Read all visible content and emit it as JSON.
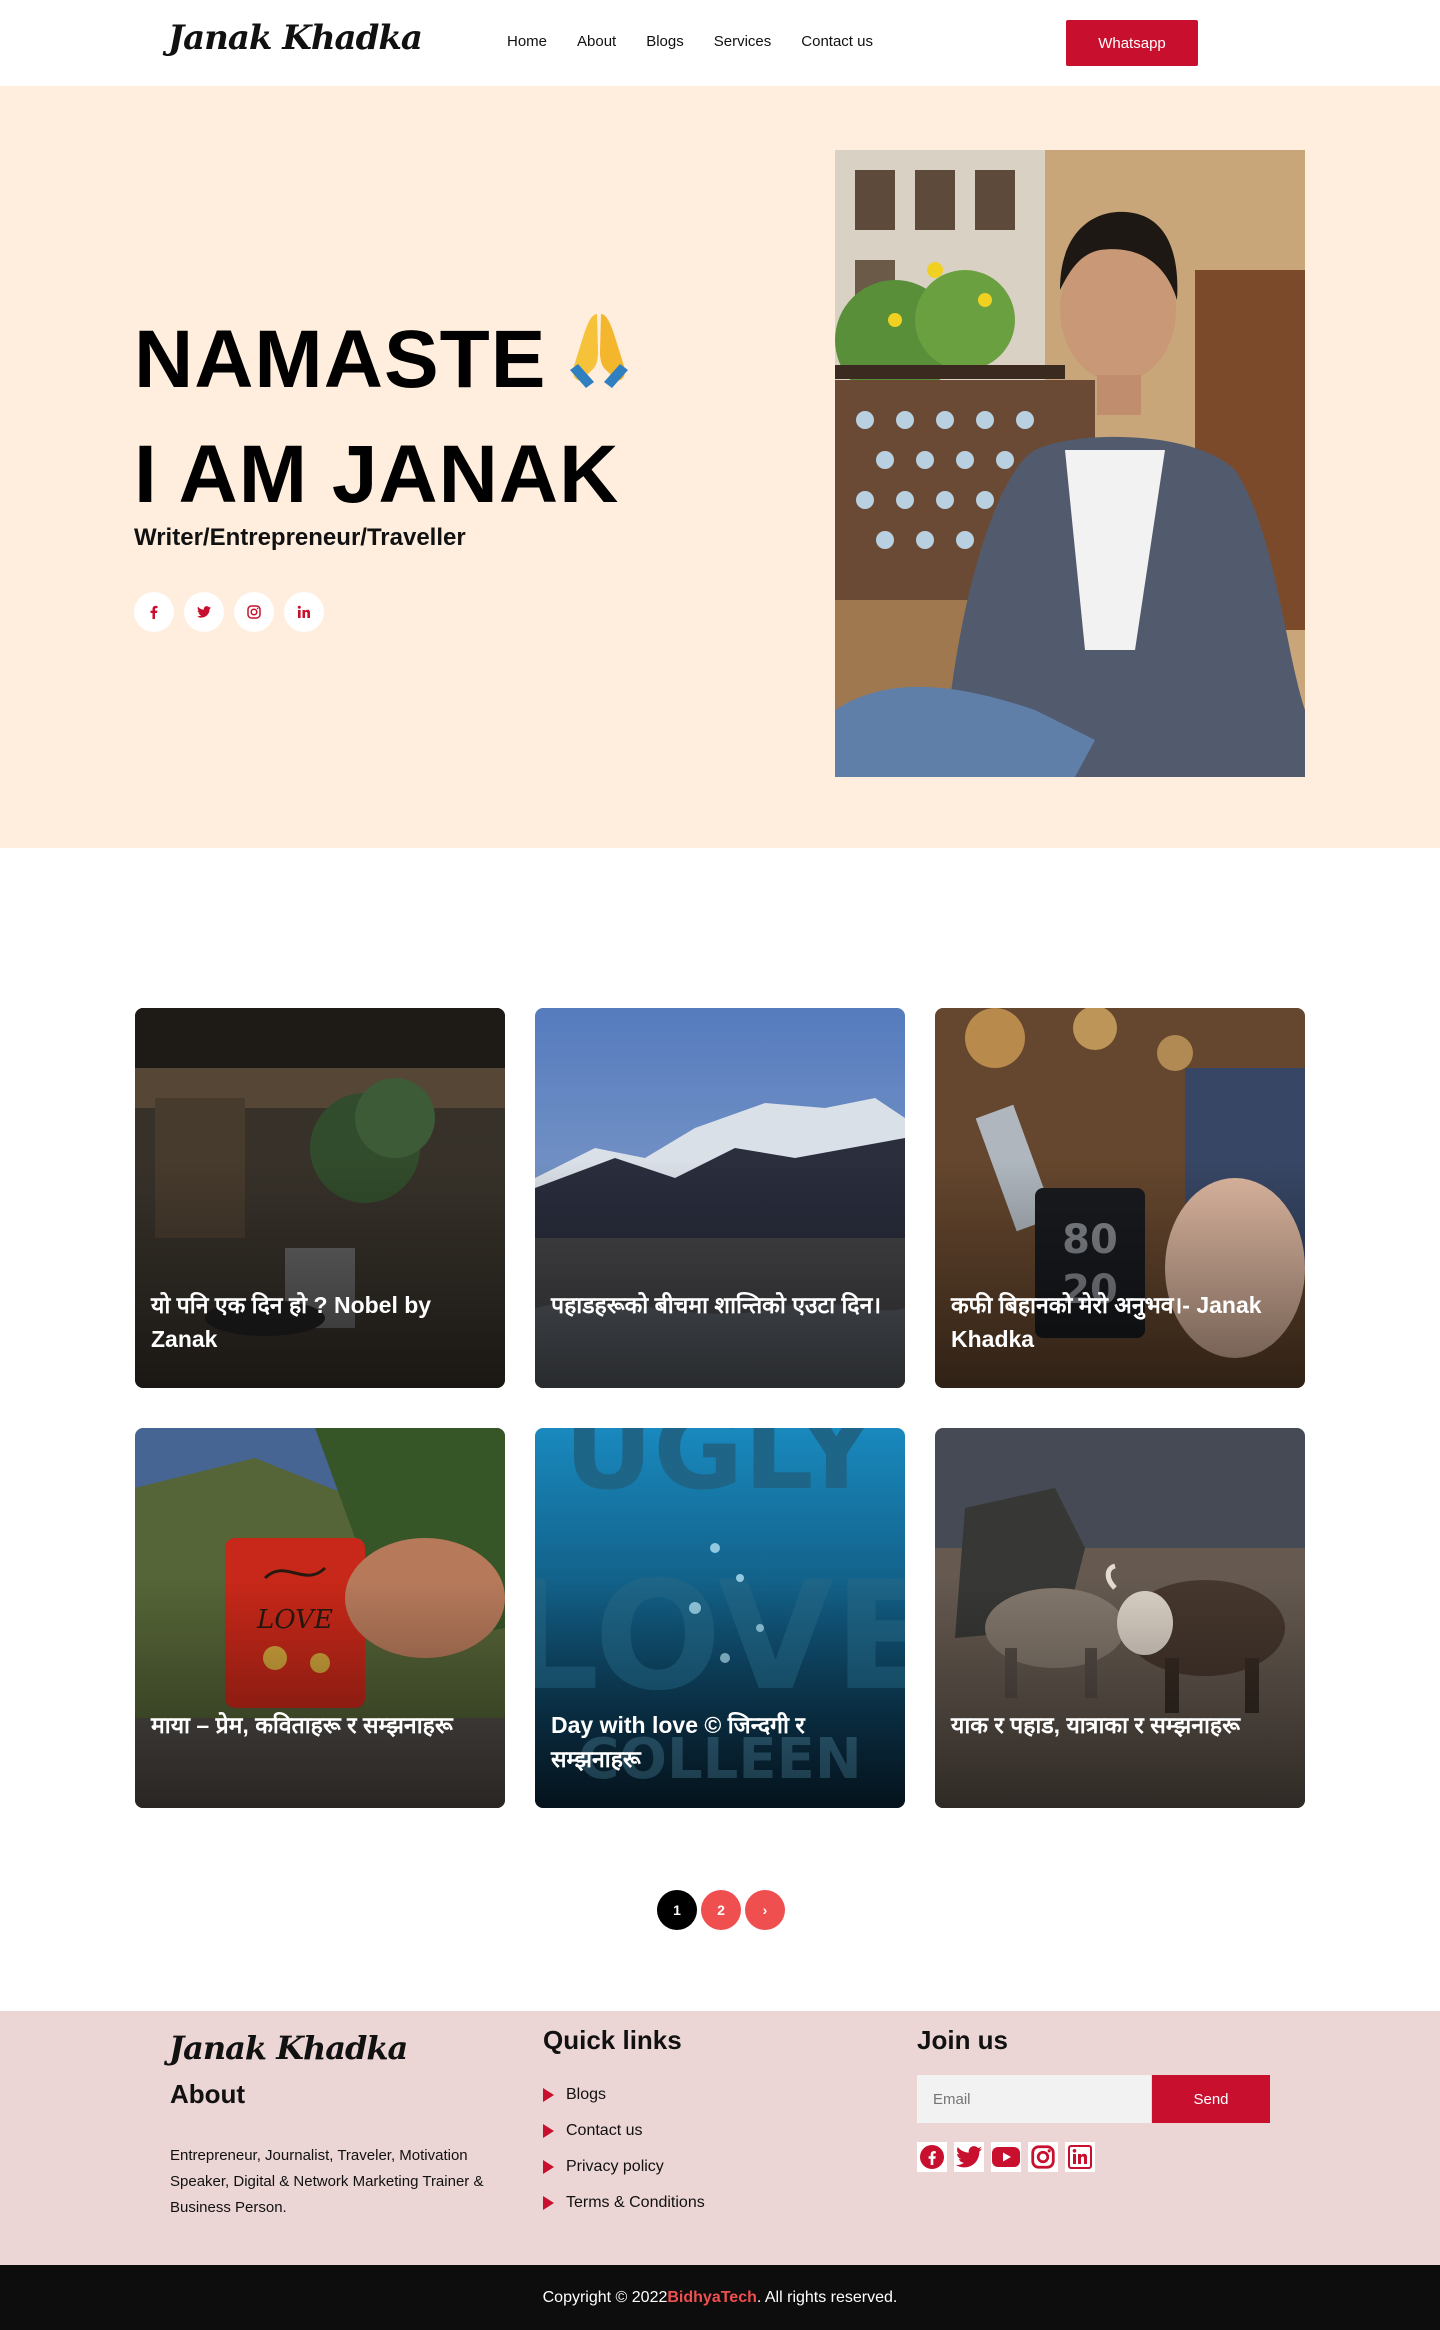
{
  "header": {
    "logo": "Janak Khadka",
    "nav": [
      "Home",
      "About",
      "Blogs",
      "Services",
      "Contact us"
    ],
    "cta": "Whatsapp"
  },
  "hero": {
    "line1": "NAMASTE",
    "line2": "I AM JANAK",
    "role": "Writer/Entrepreneur/Traveller",
    "socials": [
      "facebook-icon",
      "twitter-icon",
      "instagram-icon",
      "linkedin-icon"
    ]
  },
  "blogs": [
    {
      "title": "यो पनि एक दिन हो ? Nobel by Zanak",
      "scene": "cafe"
    },
    {
      "title": "पहाडहरूको बीचमा शान्तिको एउटा दिन।",
      "scene": "mountain"
    },
    {
      "title": "कफी बिहानको मेरो अनुभव।- Janak Khadka",
      "scene": "mug"
    },
    {
      "title": "माया – प्रेम, कविताहरू र सम्झनाहरू",
      "scene": "redmug"
    },
    {
      "title": "Day with love © जिन्दगी र सम्झनाहरू",
      "scene": "book"
    },
    {
      "title": "याक र पहाड, यात्राका र सम्झनाहरू",
      "scene": "yak"
    }
  ],
  "pagination": {
    "pages": [
      "1",
      "2"
    ],
    "next": "›",
    "current": "1"
  },
  "footer": {
    "logo": "Janak Khadka",
    "about_heading": "About",
    "about_text": "Entrepreneur, Journalist, Traveler,  Motivation Speaker, Digital & Network Marketing Trainer & Business Person.",
    "quick_heading": "Quick links",
    "quick_links": [
      "Blogs",
      "Contact us",
      "Privacy policy",
      "Terms & Conditions"
    ],
    "join_heading": "Join us",
    "email_placeholder": "Email",
    "send_label": "Send",
    "social_icons": [
      "facebook-icon",
      "twitter-icon",
      "youtube-icon",
      "instagram-icon",
      "linkedin-icon"
    ]
  },
  "copyright": {
    "prefix": "Copyright © 2022 ",
    "brand": "BidhyaTech",
    "suffix": ". All rights reserved."
  },
  "colors": {
    "accent": "#c8102e",
    "hero_bg": "#ffeedd",
    "footer_bg": "#ecd5d5",
    "pager_red": "#f04f4f"
  }
}
